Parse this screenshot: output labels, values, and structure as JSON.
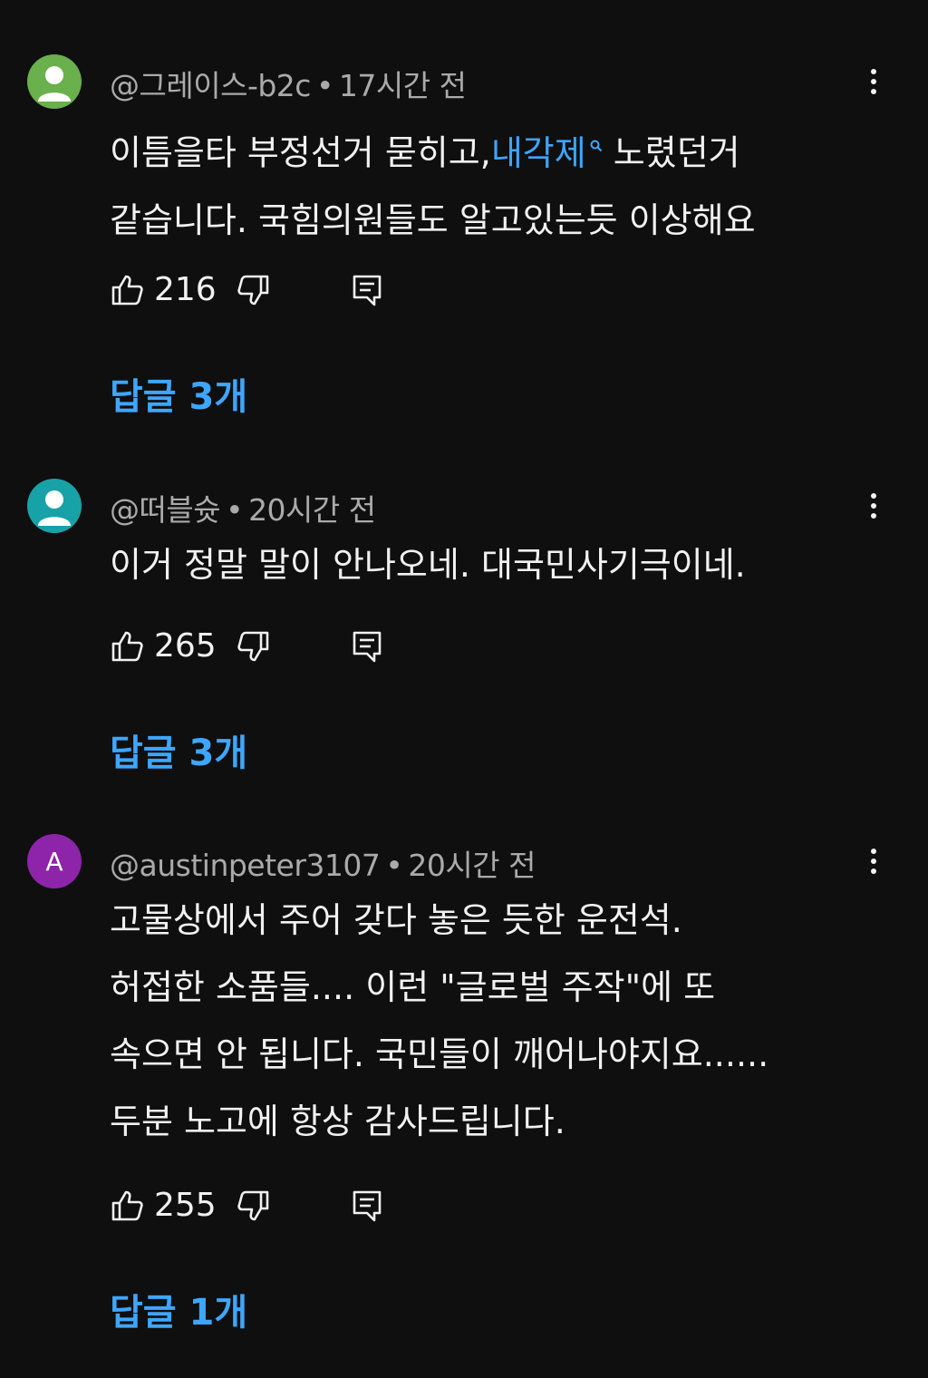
{
  "comments": [
    {
      "avatar_color": "#6ab04c",
      "author": "@그레이스-b2c",
      "separator": "•",
      "time": "17시간 전",
      "text_lines": [
        "이틈을타 부정선거 묻히고,",
        "같습니다.   국힘의원들도 알고있는듯 이상해요"
      ],
      "link_text": "내각제",
      "after_link": "노렸던거",
      "likes": "216",
      "replies_label": "답글 3개"
    },
    {
      "avatar_color": "#17a2a8",
      "author": "@떠블슛",
      "separator": "•",
      "time": "20시간 전",
      "text_lines": [
        "이거 정말 말이 안나오네. 대국민사기극이네."
      ],
      "likes": "265",
      "replies_label": "답글 3개"
    },
    {
      "avatar_color": "#8e24aa",
      "avatar_letter": "A",
      "author": "@austinpeter3107",
      "separator": "•",
      "time": "20시간 전",
      "text_lines": [
        "고물상에서 주어 갖다 놓은 듯한 운전석.",
        "허접한 소품들.... 이런 \"글로벌 주작\"에 또",
        "속으면 안 됩니다. 국민들이 깨어나야지요......",
        "두분 노고에 항상 감사드립니다."
      ],
      "likes": "255",
      "replies_label": "답글 1개"
    }
  ]
}
